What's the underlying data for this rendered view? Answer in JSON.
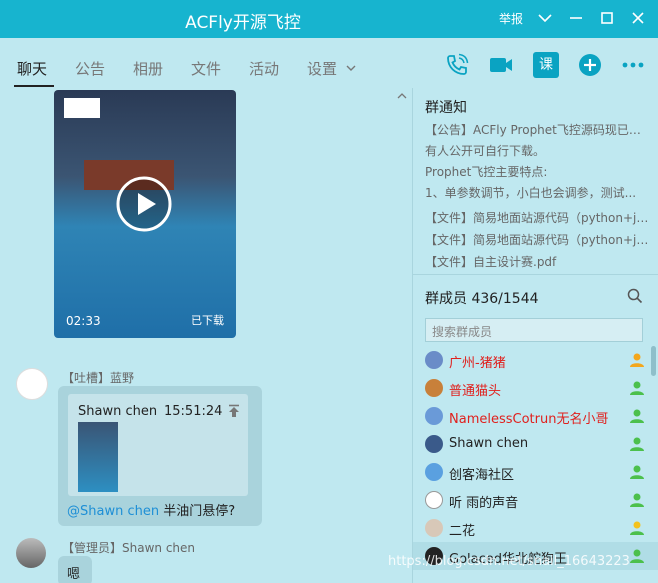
{
  "window": {
    "title": "ACFly开源飞控",
    "report": "举报"
  },
  "tabs": [
    {
      "label": "聊天"
    },
    {
      "label": "公告"
    },
    {
      "label": "相册"
    },
    {
      "label": "文件"
    },
    {
      "label": "活动"
    },
    {
      "label": "设置"
    }
  ],
  "toolbar_icons": [
    "phone-icon",
    "video-call-icon",
    "course-icon",
    "add-icon",
    "more-icon"
  ],
  "toolbar": {
    "course_label": "课"
  },
  "chat": {
    "video": {
      "duration": "02:33",
      "status": "已下载"
    },
    "messages": [
      {
        "role": "【吐槽】",
        "sender": "蓝野",
        "quote": {
          "name": "Shawn chen",
          "time": "15:51:24"
        },
        "mention": "@Shawn chen",
        "text": " 半油门悬停?"
      },
      {
        "role": "【管理员】",
        "sender": "Shawn chen",
        "text": "嗯"
      }
    ]
  },
  "notice": {
    "title": "群通知",
    "lines": [
      "【公告】ACFly Prophet飞控源码现已向所",
      "有人公开可自行下载。",
      "Prophet飞控主要特点:",
      "1、单参数调节，小白也会调参，测试...",
      "【文件】简易地面站源代码（python+js...",
      "【文件】简易地面站源代码（python+js...",
      "【文件】自主设计赛.pdf"
    ]
  },
  "members": {
    "title": "群成员 436/1544",
    "search_placeholder": "搜索群成员",
    "list": [
      {
        "name": "广州-猪猪",
        "color": "#e0201d"
      },
      {
        "name": "普通猫头",
        "color": "#e0201d"
      },
      {
        "name": "NamelessCotrun无名小哥",
        "color": "#e0201d"
      },
      {
        "name": "Shawn chen",
        "color": "#222222"
      },
      {
        "name": "创客海社区",
        "color": "#222222"
      },
      {
        "name": "听 雨的声音",
        "color": "#222222"
      },
      {
        "name": "二花",
        "color": "#222222"
      },
      {
        "name": "Golaced华北舵狗王",
        "color": "#222222"
      }
    ]
  },
  "watermark": "https://blog.csdn.net/snail_16643223"
}
